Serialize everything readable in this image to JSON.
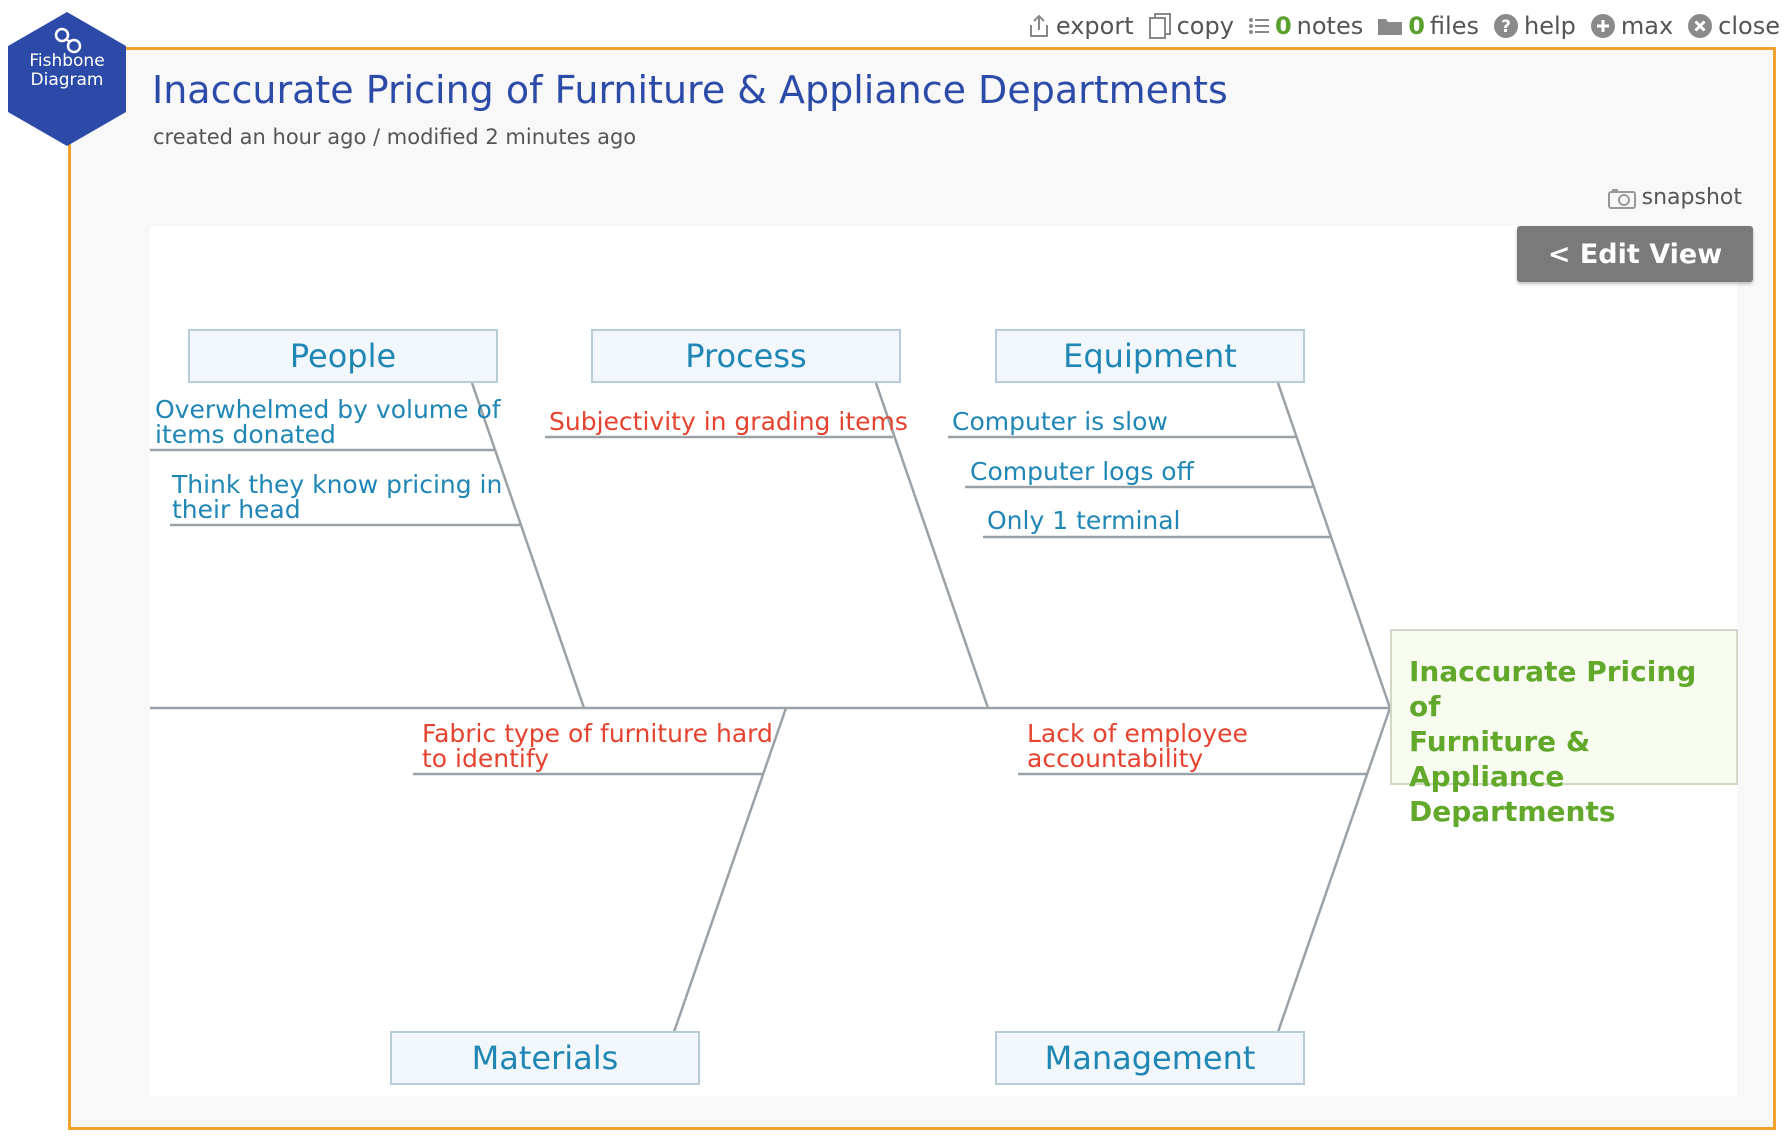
{
  "toolbar": {
    "export_label": "export",
    "copy_label": "copy",
    "notes_count": "0",
    "notes_label": "notes",
    "files_count": "0",
    "files_label": "files",
    "help_label": "help",
    "max_label": "max",
    "close_label": "close"
  },
  "badge": {
    "line1": "Fishbone",
    "line2": "Diagram"
  },
  "header": {
    "title": "Inaccurate Pricing of Furniture & Appliance Departments",
    "subtitle": "created an hour ago / modified 2 minutes ago"
  },
  "snapshot_label": "snapshot",
  "edit_view_label": "< Edit View",
  "diagram": {
    "categories": {
      "people": "People",
      "process": "Process",
      "equipment": "Equipment",
      "materials": "Materials",
      "management": "Management"
    },
    "causes": {
      "people_1": [
        "Overwhelmed by volume of",
        "items donated"
      ],
      "people_2": [
        "Think they know pricing in",
        "their head"
      ],
      "process_1": "Subjectivity in grading items",
      "equipment_1": "Computer is slow",
      "equipment_2": "Computer logs off",
      "equipment_3": "Only 1 terminal",
      "materials_1": [
        "Fabric type of furniture hard",
        "to identify"
      ],
      "management_1": [
        "Lack of employee",
        "accountability"
      ]
    },
    "effect": [
      "Inaccurate Pricing of",
      "Furniture & Appliance",
      "Departments"
    ]
  },
  "colors": {
    "frame_border": "#f0a22d",
    "title": "#2c4ba8",
    "category_text": "#1f86b5",
    "cause_blue": "#1f86b5",
    "cause_red": "#e5432f",
    "effect_text": "#62a82b",
    "badge": "#2c4ba8"
  },
  "icons": [
    "export-icon",
    "copy-icon",
    "notes-icon",
    "folder-icon",
    "help-icon",
    "plus-circle-icon",
    "close-circle-icon",
    "camera-icon",
    "link-icon"
  ]
}
